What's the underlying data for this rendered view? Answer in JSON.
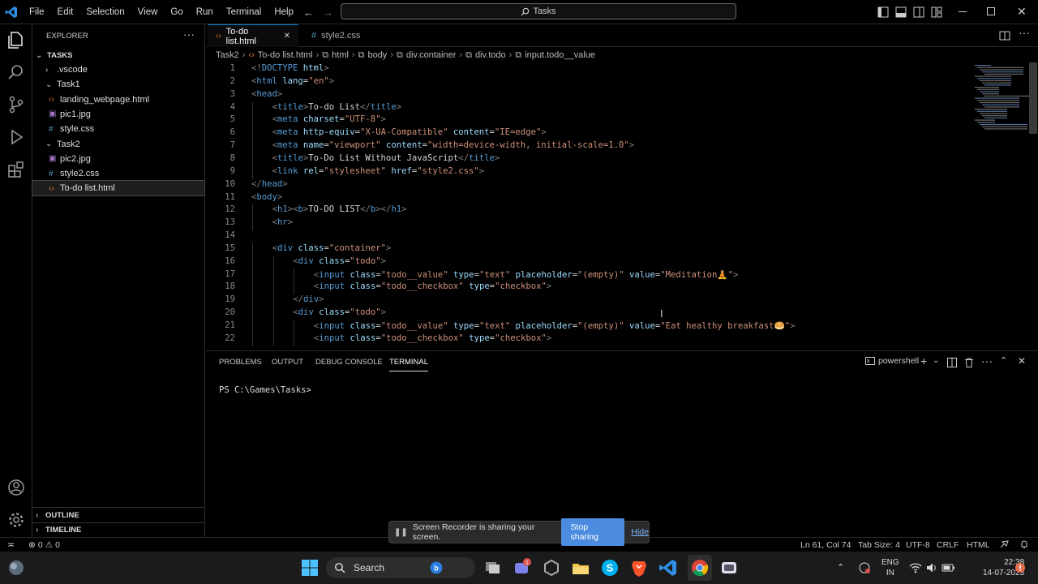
{
  "menu": [
    "File",
    "Edit",
    "Selection",
    "View",
    "Go",
    "Run",
    "Terminal",
    "Help"
  ],
  "search": {
    "label": "Tasks"
  },
  "explorer": {
    "title": "EXPLORER",
    "root": "TASKS",
    "items": [
      {
        "label": ".vscode",
        "kind": "folder",
        "depth": 1,
        "collapsed": true
      },
      {
        "label": "Task1",
        "kind": "folder",
        "depth": 1,
        "collapsed": false
      },
      {
        "label": "landing_webpage.html",
        "kind": "html",
        "depth": 2
      },
      {
        "label": "pic1.jpg",
        "kind": "img",
        "depth": 2
      },
      {
        "label": "style.css",
        "kind": "css",
        "depth": 2
      },
      {
        "label": "Task2",
        "kind": "folder",
        "depth": 1,
        "collapsed": false
      },
      {
        "label": "pic2.jpg",
        "kind": "img",
        "depth": 2
      },
      {
        "label": "style2.css",
        "kind": "css",
        "depth": 2
      },
      {
        "label": "To-do list.html",
        "kind": "html",
        "depth": 2,
        "selected": true
      }
    ],
    "outline": "OUTLINE",
    "timeline": "TIMELINE"
  },
  "tabs": [
    {
      "label": "To-do list.html",
      "active": true
    },
    {
      "label": "style2.css",
      "active": false
    }
  ],
  "breadcrumb": [
    "Task2",
    "To-do list.html",
    "html",
    "body",
    "div.container",
    "div.todo",
    "input.todo__value"
  ],
  "code": [
    {
      "n": "1",
      "t": [
        [
          "pn",
          "<!"
        ],
        [
          "tg",
          "DOCTYPE"
        ],
        [
          "at",
          " html"
        ],
        [
          "pn",
          ">"
        ]
      ],
      "indent": 0
    },
    {
      "n": "2",
      "t": [
        [
          "pn",
          "<"
        ],
        [
          "tg",
          "html"
        ],
        [
          "at",
          " lang"
        ],
        [
          "tx",
          "="
        ],
        [
          "st",
          "\"en\""
        ],
        [
          "pn",
          ">"
        ]
      ],
      "indent": 0
    },
    {
      "n": "3",
      "t": [
        [
          "pn",
          "<"
        ],
        [
          "tg",
          "head"
        ],
        [
          "pn",
          ">"
        ]
      ],
      "indent": 0
    },
    {
      "n": "4",
      "t": [
        [
          "pn",
          "<"
        ],
        [
          "tg",
          "title"
        ],
        [
          "pn",
          ">"
        ],
        [
          "tx",
          "To-do List"
        ],
        [
          "pn",
          "</"
        ],
        [
          "tg",
          "title"
        ],
        [
          "pn",
          ">"
        ]
      ],
      "indent": 1
    },
    {
      "n": "5",
      "t": [
        [
          "pn",
          "<"
        ],
        [
          "tg",
          "meta"
        ],
        [
          "at",
          " charset"
        ],
        [
          "tx",
          "="
        ],
        [
          "st",
          "\"UTF-8\""
        ],
        [
          "pn",
          ">"
        ]
      ],
      "indent": 1
    },
    {
      "n": "6",
      "t": [
        [
          "pn",
          "<"
        ],
        [
          "tg",
          "meta"
        ],
        [
          "at",
          " http-equiv"
        ],
        [
          "tx",
          "="
        ],
        [
          "st",
          "\"X-UA-Compatible\""
        ],
        [
          "at",
          " content"
        ],
        [
          "tx",
          "="
        ],
        [
          "st",
          "\"IE=edge\""
        ],
        [
          "pn",
          ">"
        ]
      ],
      "indent": 1
    },
    {
      "n": "7",
      "t": [
        [
          "pn",
          "<"
        ],
        [
          "tg",
          "meta"
        ],
        [
          "at",
          " name"
        ],
        [
          "tx",
          "="
        ],
        [
          "st",
          "\"viewport\""
        ],
        [
          "at",
          " content"
        ],
        [
          "tx",
          "="
        ],
        [
          "st",
          "\"width=device-width, initial-scale=1.0\""
        ],
        [
          "pn",
          ">"
        ]
      ],
      "indent": 1
    },
    {
      "n": "8",
      "t": [
        [
          "pn",
          "<"
        ],
        [
          "tg",
          "title"
        ],
        [
          "pn",
          ">"
        ],
        [
          "tx",
          "To-Do List Without JavaScript"
        ],
        [
          "pn",
          "</"
        ],
        [
          "tg",
          "title"
        ],
        [
          "pn",
          ">"
        ]
      ],
      "indent": 1
    },
    {
      "n": "9",
      "t": [
        [
          "pn",
          "<"
        ],
        [
          "tg",
          "link"
        ],
        [
          "at",
          " rel"
        ],
        [
          "tx",
          "="
        ],
        [
          "st",
          "\"stylesheet\""
        ],
        [
          "at",
          " href"
        ],
        [
          "tx",
          "="
        ],
        [
          "st",
          "\"style2.css\""
        ],
        [
          "pn",
          ">"
        ]
      ],
      "indent": 1
    },
    {
      "n": "10",
      "t": [
        [
          "pn",
          "</"
        ],
        [
          "tg",
          "head"
        ],
        [
          "pn",
          ">"
        ]
      ],
      "indent": 0
    },
    {
      "n": "11",
      "t": [
        [
          "pn",
          "<"
        ],
        [
          "tg",
          "body"
        ],
        [
          "pn",
          ">"
        ]
      ],
      "indent": 0
    },
    {
      "n": "12",
      "t": [
        [
          "pn",
          "<"
        ],
        [
          "tg",
          "h1"
        ],
        [
          "pn",
          "><"
        ],
        [
          "tg",
          "b"
        ],
        [
          "pn",
          ">"
        ],
        [
          "tx",
          "TO-DO LIST"
        ],
        [
          "pn",
          "</"
        ],
        [
          "tg",
          "b"
        ],
        [
          "pn",
          "></"
        ],
        [
          "tg",
          "h1"
        ],
        [
          "pn",
          ">"
        ]
      ],
      "indent": 1
    },
    {
      "n": "13",
      "t": [
        [
          "pn",
          "<"
        ],
        [
          "tg",
          "hr"
        ],
        [
          "pn",
          ">"
        ]
      ],
      "indent": 1
    },
    {
      "n": "14",
      "t": [],
      "indent": 0
    },
    {
      "n": "15",
      "t": [
        [
          "pn",
          "<"
        ],
        [
          "tg",
          "div"
        ],
        [
          "at",
          " class"
        ],
        [
          "tx",
          "="
        ],
        [
          "st",
          "\"container\""
        ],
        [
          "pn",
          ">"
        ]
      ],
      "indent": 1
    },
    {
      "n": "16",
      "t": [
        [
          "pn",
          "<"
        ],
        [
          "tg",
          "div"
        ],
        [
          "at",
          " class"
        ],
        [
          "tx",
          "="
        ],
        [
          "st",
          "\"todo\""
        ],
        [
          "pn",
          ">"
        ]
      ],
      "indent": 2
    },
    {
      "n": "17",
      "t": [
        [
          "pn",
          "<"
        ],
        [
          "tg",
          "input"
        ],
        [
          "at",
          " class"
        ],
        [
          "tx",
          "="
        ],
        [
          "st",
          "\"todo__value\""
        ],
        [
          "at",
          " type"
        ],
        [
          "tx",
          "="
        ],
        [
          "st",
          "\"text\""
        ],
        [
          "at",
          " placeholder"
        ],
        [
          "tx",
          "="
        ],
        [
          "st",
          "\"(empty)\""
        ],
        [
          "at",
          " value"
        ],
        [
          "tx",
          "="
        ],
        [
          "st",
          "\"Meditation🧘\""
        ],
        [
          "pn",
          ">"
        ]
      ],
      "indent": 3
    },
    {
      "n": "18",
      "t": [
        [
          "pn",
          "<"
        ],
        [
          "tg",
          "input"
        ],
        [
          "at",
          " class"
        ],
        [
          "tx",
          "="
        ],
        [
          "st",
          "\"todo__checkbox\""
        ],
        [
          "at",
          " type"
        ],
        [
          "tx",
          "="
        ],
        [
          "st",
          "\"checkbox\""
        ],
        [
          "pn",
          ">"
        ]
      ],
      "indent": 3
    },
    {
      "n": "19",
      "t": [
        [
          "pn",
          "</"
        ],
        [
          "tg",
          "div"
        ],
        [
          "pn",
          ">"
        ]
      ],
      "indent": 2
    },
    {
      "n": "20",
      "t": [
        [
          "pn",
          "<"
        ],
        [
          "tg",
          "div"
        ],
        [
          "at",
          " class"
        ],
        [
          "tx",
          "="
        ],
        [
          "st",
          "\"todo\""
        ],
        [
          "pn",
          ">"
        ]
      ],
      "indent": 2
    },
    {
      "n": "21",
      "t": [
        [
          "pn",
          "<"
        ],
        [
          "tg",
          "input"
        ],
        [
          "at",
          " class"
        ],
        [
          "tx",
          "="
        ],
        [
          "st",
          "\"todo__value\""
        ],
        [
          "at",
          " type"
        ],
        [
          "tx",
          "="
        ],
        [
          "st",
          "\"text\""
        ],
        [
          "at",
          " placeholder"
        ],
        [
          "tx",
          "="
        ],
        [
          "st",
          "\"(empty)\""
        ],
        [
          "at",
          " value"
        ],
        [
          "tx",
          "="
        ],
        [
          "st",
          "\"Eat healthy breakfast🥯\""
        ],
        [
          "pn",
          ">"
        ]
      ],
      "indent": 3
    },
    {
      "n": "22",
      "t": [
        [
          "pn",
          "<"
        ],
        [
          "tg",
          "input"
        ],
        [
          "at",
          " class"
        ],
        [
          "tx",
          "="
        ],
        [
          "st",
          "\"todo__checkbox\""
        ],
        [
          "at",
          " type"
        ],
        [
          "tx",
          "="
        ],
        [
          "st",
          "\"checkbox\""
        ],
        [
          "pn",
          ">"
        ]
      ],
      "indent": 3
    }
  ],
  "panel": {
    "tabs": [
      "PROBLEMS",
      "OUTPUT",
      "DEBUG CONSOLE",
      "TERMINAL"
    ],
    "active_tab": "TERMINAL",
    "shell": "powershell",
    "prompt": "PS C:\\Games\\Tasks>"
  },
  "status": {
    "errors": "0",
    "warnings": "0",
    "position": "Ln 61, Col 74",
    "tab_size": "Tab Size: 4",
    "encoding": "UTF-8",
    "eol": "CRLF",
    "language": "HTML"
  },
  "toast": {
    "message": "Screen Recorder is sharing your screen.",
    "stop": "Stop sharing",
    "hide": "Hide"
  },
  "taskbar": {
    "search": "Search",
    "lang1": "ENG",
    "lang2": "IN",
    "time": "22:38",
    "date": "14-07-2023",
    "badge": "1"
  },
  "colors": {
    "accent": "#0078d4",
    "tag": "#569cd6",
    "attr": "#9cdcfe",
    "string": "#ce9178"
  }
}
